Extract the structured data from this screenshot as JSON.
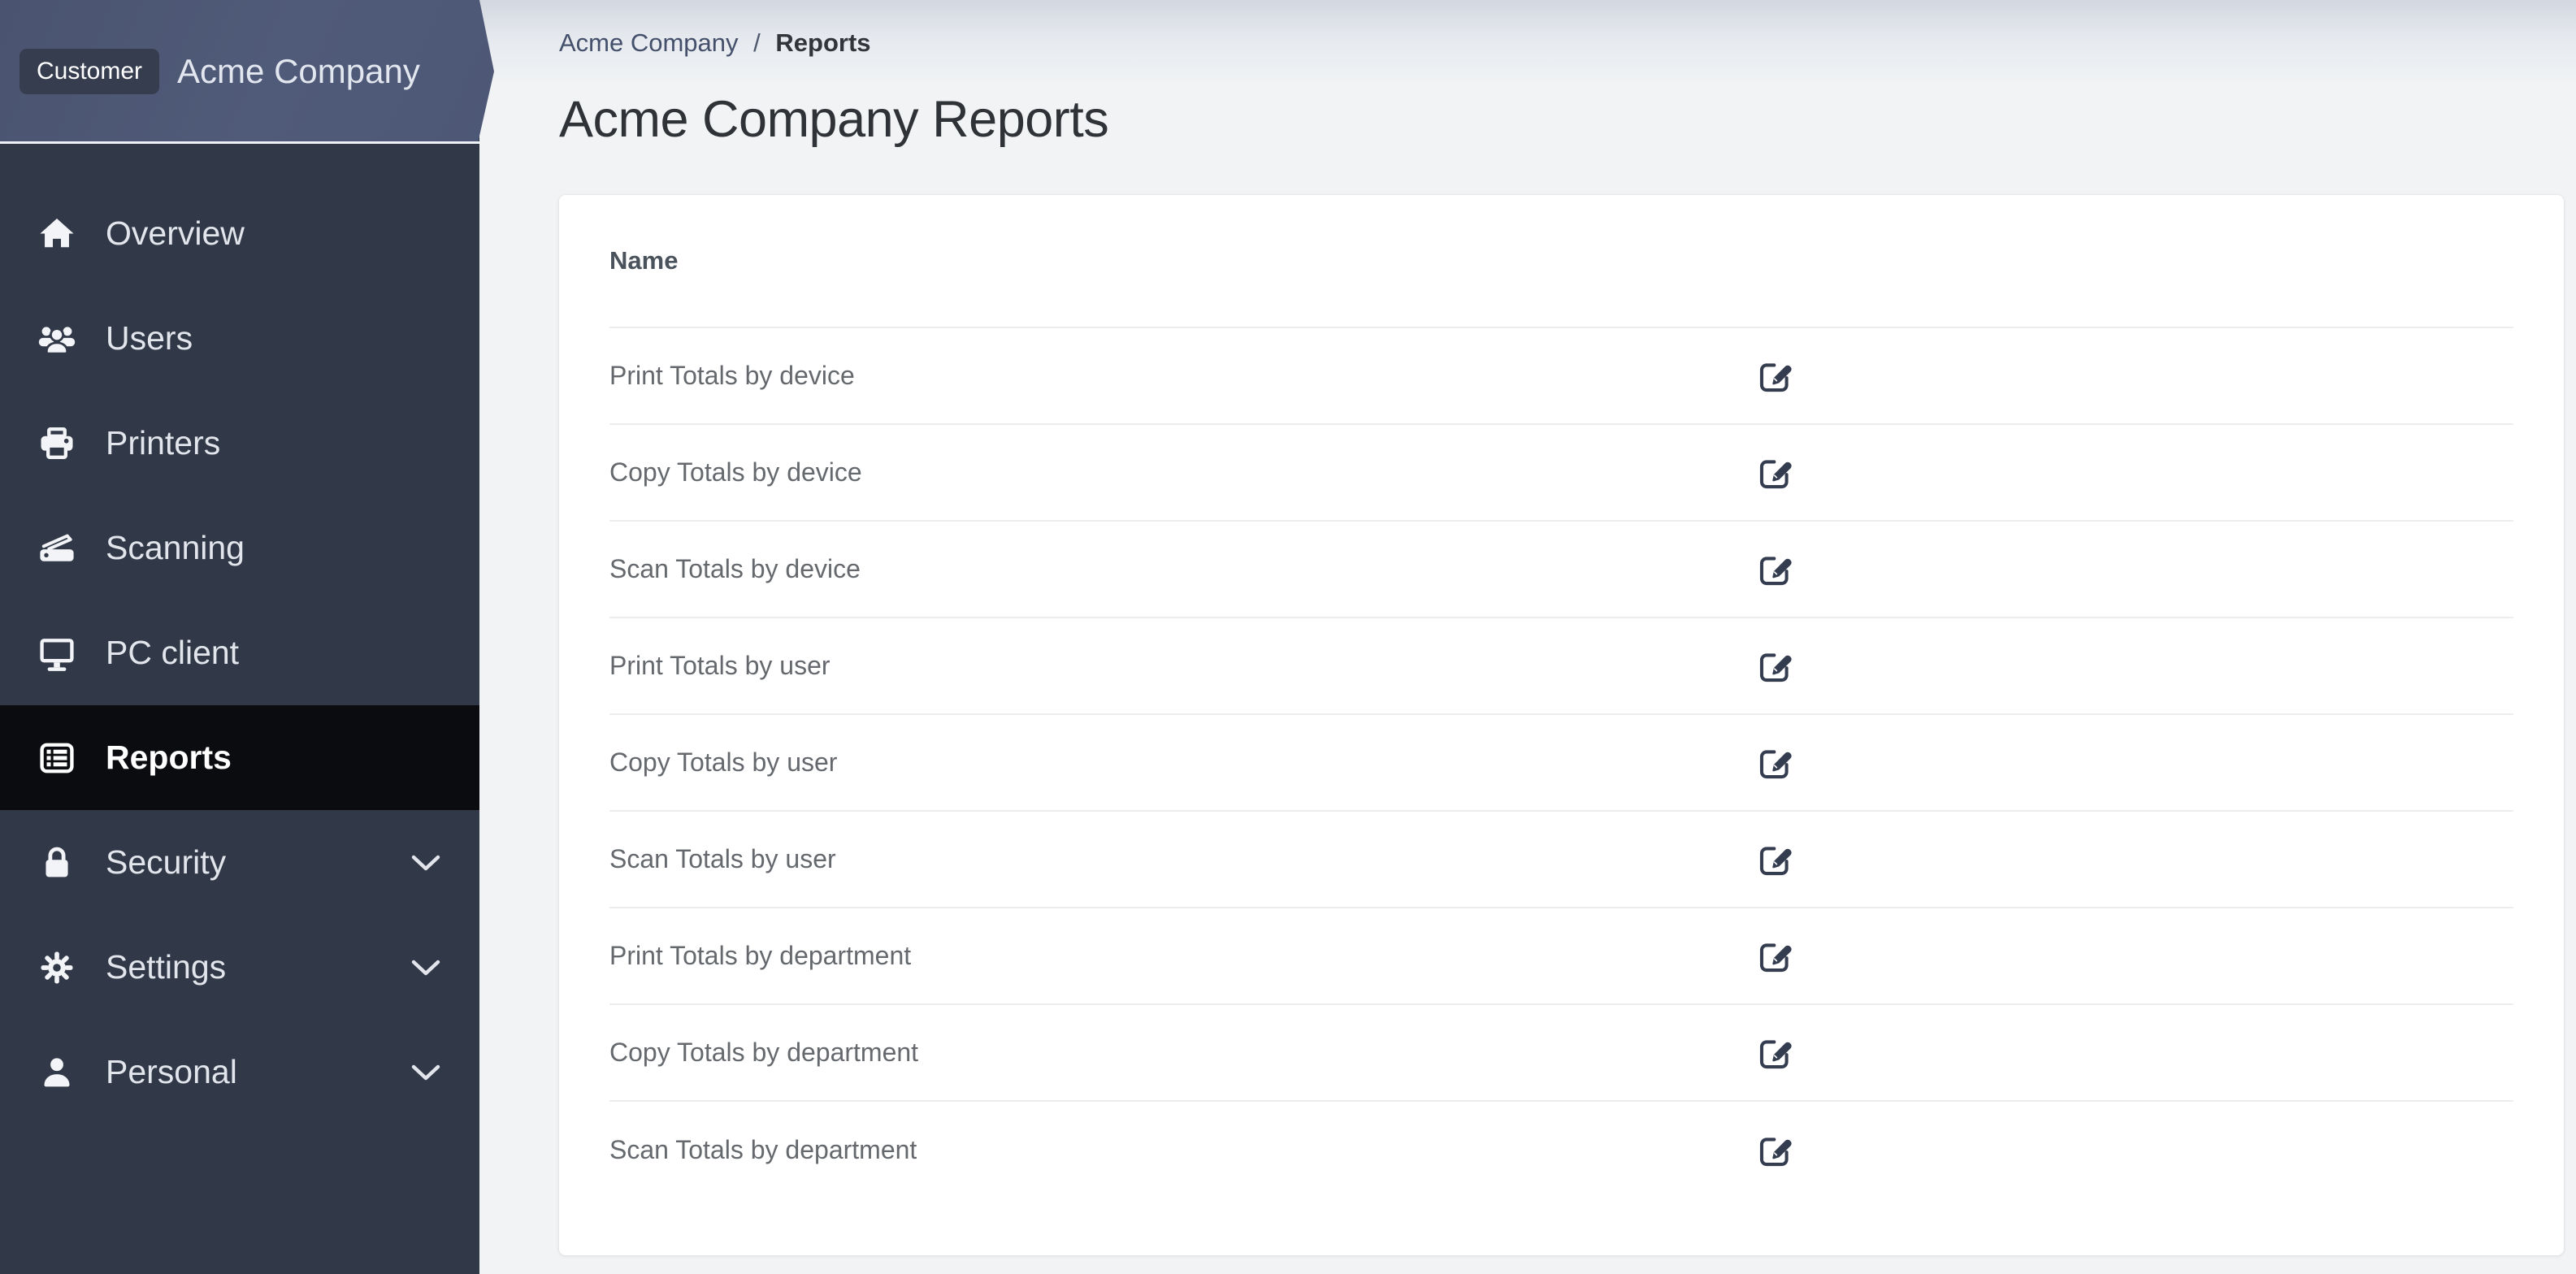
{
  "banner": {
    "badge": "Customer",
    "company": "Acme Company"
  },
  "sidebar": {
    "items": [
      {
        "label": "Overview",
        "icon": "home-icon",
        "active": false,
        "expandable": false
      },
      {
        "label": "Users",
        "icon": "users-group-icon",
        "active": false,
        "expandable": false
      },
      {
        "label": "Printers",
        "icon": "printer-icon",
        "active": false,
        "expandable": false
      },
      {
        "label": "Scanning",
        "icon": "scanner-icon",
        "active": false,
        "expandable": false
      },
      {
        "label": "PC client",
        "icon": "monitor-icon",
        "active": false,
        "expandable": false
      },
      {
        "label": "Reports",
        "icon": "table-list-icon",
        "active": true,
        "expandable": false
      },
      {
        "label": "Security",
        "icon": "lock-icon",
        "active": false,
        "expandable": true
      },
      {
        "label": "Settings",
        "icon": "gear-icon",
        "active": false,
        "expandable": true
      },
      {
        "label": "Personal",
        "icon": "person-icon",
        "active": false,
        "expandable": true
      }
    ],
    "expander_icon": "chevron-down-icon"
  },
  "breadcrumb": {
    "parent": "Acme Company",
    "separator": "/",
    "current": "Reports"
  },
  "page": {
    "title": "Acme Company Reports"
  },
  "reports_table": {
    "name_header": "Name",
    "row_action_icon": "edit-pen-square-icon",
    "rows": [
      {
        "name": "Print Totals by device"
      },
      {
        "name": "Copy Totals by device"
      },
      {
        "name": "Scan Totals by device"
      },
      {
        "name": "Print Totals by user"
      },
      {
        "name": "Copy Totals by user"
      },
      {
        "name": "Scan Totals by user"
      },
      {
        "name": "Print Totals by department"
      },
      {
        "name": "Copy Totals by department"
      },
      {
        "name": "Scan Totals by department"
      }
    ]
  },
  "colors": {
    "sidebar_bg": "#313948",
    "active_item_bg": "#0a0c10",
    "banner_bg": "#4d5876",
    "badge_bg": "#353d4f",
    "main_bg": "#f2f3f5",
    "main_bg_top": "#d2d7e0",
    "card_bg": "#ffffff",
    "divider": "#ebedef",
    "row_text": "#65696e",
    "header_text": "#4a525c",
    "title_text": "#2f3337",
    "breadcrumb_link": "#44506b",
    "edit_icon": "#343c4f"
  }
}
